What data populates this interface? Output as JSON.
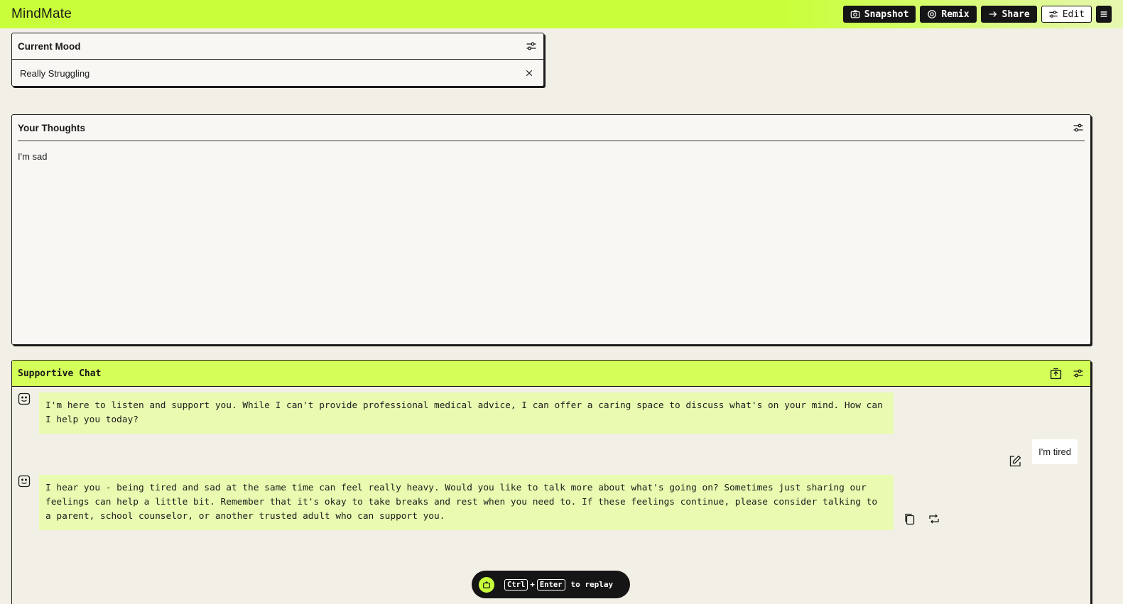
{
  "app": {
    "title": "MindMate"
  },
  "toolbar": {
    "snapshot": "Snapshot",
    "remix": "Remix",
    "share": "Share",
    "edit": "Edit"
  },
  "mood": {
    "title": "Current Mood",
    "value": "Really Struggling"
  },
  "thoughts": {
    "title": "Your Thoughts",
    "text": "I'm sad"
  },
  "chat": {
    "title": "Supportive Chat",
    "messages": [
      {
        "role": "assistant",
        "text": "I'm here to listen and support you. While I can't provide professional medical advice, I can offer a caring space to discuss what's on your mind. How can I help you today?"
      },
      {
        "role": "user",
        "text": "I'm tired"
      },
      {
        "role": "assistant",
        "text": "I hear you - being tired and sad at the same time can feel really heavy. Would you like to talk more about what's going on? Sometimes just sharing our feelings can help a little bit. Remember that it's okay to take breaks and rest when you need to. If these feelings continue, please consider talking to a parent, school counselor, or another trusted adult who can support you."
      }
    ]
  },
  "replay": {
    "key1": "Ctrl",
    "plus": "+",
    "key2": "Enter",
    "label": "to replay"
  },
  "colors": {
    "accent": "#c9ff3a",
    "chat_header": "#d4ff58",
    "ai_bubble": "#e8fbb0",
    "background": "#f2f0e6"
  }
}
